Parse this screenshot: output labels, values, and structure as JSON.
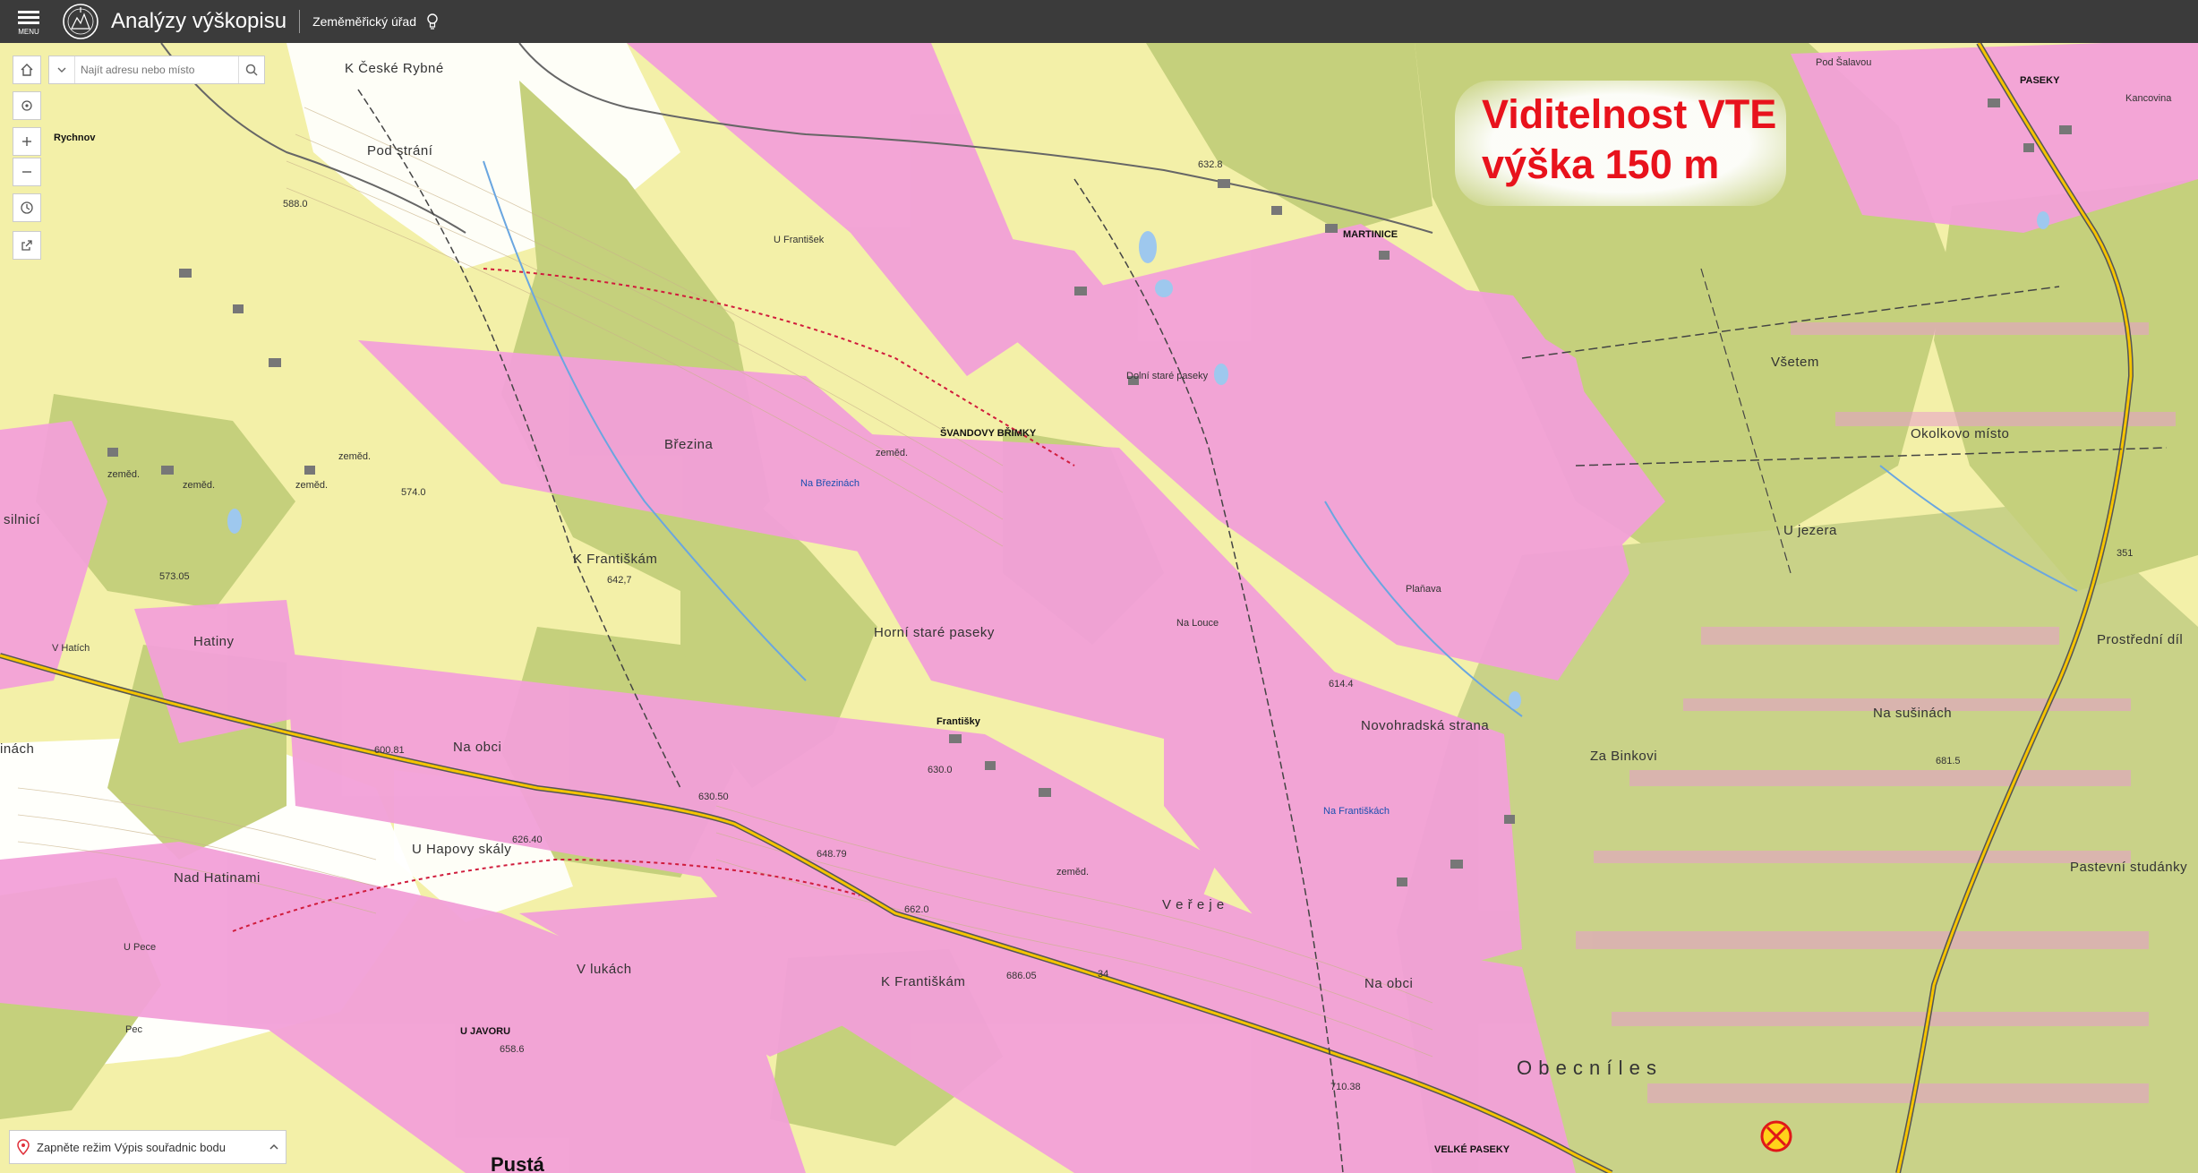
{
  "header": {
    "menu_label": "MENU",
    "app_title": "Analýzy výškopisu",
    "organization": "Zeměměřický úřad"
  },
  "search": {
    "placeholder": "Najít adresu nebo místo"
  },
  "coord_bar": {
    "text": "Zapněte režim Výpis souřadnic bodu"
  },
  "overlay": {
    "line1": "Viditelnost VTE",
    "line2": "výška 150 m",
    "color": "#e8121c"
  },
  "colors": {
    "visible_area": "#f29fd6",
    "forest": "#c6d17e",
    "meadow": "#f2ee9e",
    "open": "#ffffff",
    "road": "#f5c400"
  },
  "labels": {
    "k_ceske_rybne": "K České Rybné",
    "pod_strani": "Pod strání",
    "rychnov": "Rychnov",
    "u_frantisek": "U František",
    "brezina": "Březina",
    "na_brezinach": "Na Březinách",
    "svandovy_brimky": "ŠVANDOVY BŘIMKY",
    "dolni_stare_paseky": "Dolní staré paseky",
    "martinice": "MARTINICE",
    "pod_salavou": "Pod Šalavou",
    "paseky": "PASEKY",
    "kancovina": "Kancovina",
    "vsetem": "Všetem",
    "okolkovo_misto": "Okolkovo místo",
    "u_jezera": "U jezera",
    "prostredni_dil": "Prostřední díl",
    "na_susinach": "Na sušinách",
    "pastevni_studanky": "Pastevní studánky",
    "k_frantiskam": "K Františkám",
    "k_frantiskam2": "K Františkám",
    "horni_stare_paseky": "Horní staré paseky",
    "na_louce": "Na Louce",
    "planava": "Plaňava",
    "novohradska_strana": "Novohradská strana",
    "za_binkovi": "Za Binkovi",
    "frantisky": "Františky",
    "na_frantiskach": "Na Františkách",
    "hatiny": "Hatiny",
    "v_hatich": "V Hatích",
    "na_obci": "Na obci",
    "na_obci2": "Na obci",
    "u_hapovy_skaly": "U Hapovy skály",
    "nad_hatinami": "Nad Hatinami",
    "u_pece": "U Pece",
    "pec": "Pec",
    "v_lukach": "V lukách",
    "u_javoru": "U JAVORU",
    "veleje": "V e ř e j e",
    "obecni_les": "O b e c n í   l e s",
    "velke_paseky": "VELKÉ PASEKY",
    "pusta": "Pustá",
    "silnici": "silnicí",
    "inach": "inách",
    "zemed1": "zeměd.",
    "zemed2": "zeměd.",
    "zemed3": "zeměd.",
    "zemed4": "zeměd.",
    "zemed5": "zeměd.",
    "zemed6": "zeměd.",
    "road34": "34",
    "road351": "351",
    "h_6423": "642,7",
    "h_6108": "600.81",
    "h_5730": "573.05",
    "h_5740": "574.0",
    "h_6300": "630.50",
    "h_6180": "648.79",
    "h_6620": "662.0",
    "h_6860": "686.05",
    "h_7103": "710.38",
    "h_6815": "681.5",
    "h_6332": "632.8",
    "h_5880": "588.0",
    "h_6140": "614.4",
    "h_6300b": "630.0",
    "h_6585": "658.6",
    "h_6260": "626.40"
  }
}
